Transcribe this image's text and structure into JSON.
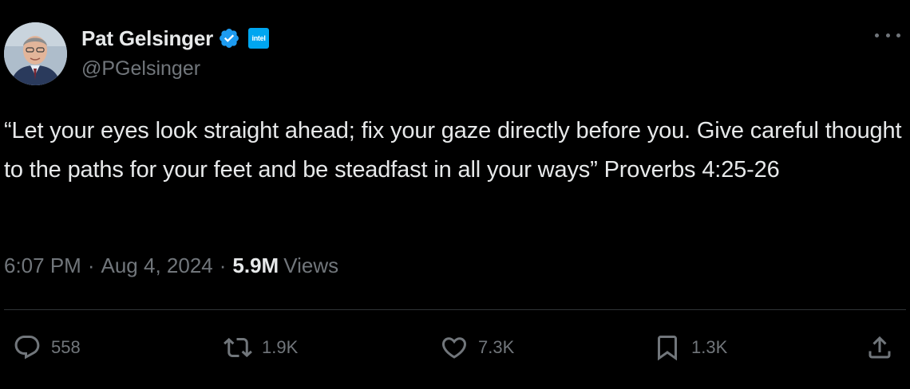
{
  "author": {
    "display_name": "Pat Gelsinger",
    "handle": "@PGelsinger",
    "verified": true,
    "affiliation_badge_text": "intel"
  },
  "tweet": {
    "text": "“Let your eyes look straight ahead; fix your gaze directly before you. Give careful thought to the paths for your feet and be steadfast in all your ways” Proverbs 4:25-26",
    "time": "6:07 PM",
    "date": "Aug 4, 2024",
    "views_count": "5.9M",
    "views_label": "Views",
    "separator": "·"
  },
  "actions": {
    "replies": "558",
    "retweets": "1.9K",
    "likes": "7.3K",
    "bookmarks": "1.3K"
  },
  "colors": {
    "background": "#000000",
    "text_primary": "#e7e9ea",
    "text_secondary": "#71767b",
    "verified_blue": "#1d9bf0",
    "intel_blue": "#00a6f0",
    "divider": "#2f3336"
  },
  "icons": {
    "verified": "verified-check-icon",
    "more": "more-horizontal-icon",
    "reply": "reply-bubble-icon",
    "retweet": "retweet-icon",
    "like": "heart-icon",
    "bookmark": "bookmark-icon",
    "share": "share-upload-icon"
  }
}
